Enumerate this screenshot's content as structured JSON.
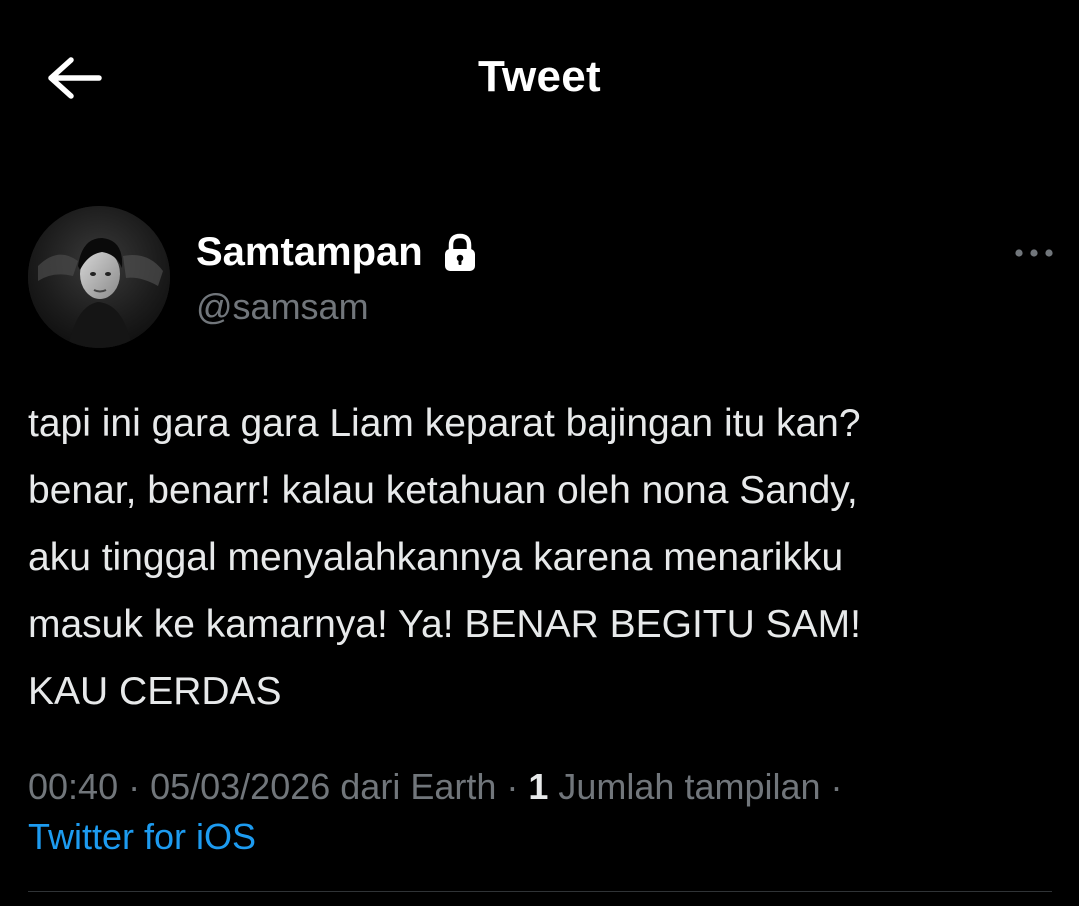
{
  "header": {
    "title": "Tweet",
    "back_icon": "arrow-left-icon"
  },
  "tweet": {
    "author": {
      "display_name": "Samtampan",
      "handle": "@samsam",
      "protected_icon": "lock-icon",
      "avatar": "profile-photo"
    },
    "more_icon": "more-horizontal-icon",
    "text": "tapi ini gara gara Liam keparat bajingan itu kan?\nbenar, benarr! kalau ketahuan oleh nona Sandy,\naku tinggal menyalahkannya karena menarikku\nmasuk ke kamarnya! Ya! BENAR BEGITU SAM!\nKAU CERDAS",
    "meta": {
      "time": "00:40",
      "separator": " · ",
      "date": "05/03/2026",
      "location_text": " dari Earth",
      "views_count": "1",
      "views_label": " Jumlah tampilan",
      "source": "Twitter for iOS"
    }
  },
  "colors": {
    "background": "#000000",
    "text_primary": "#e7e9ea",
    "text_secondary": "#71767b",
    "link": "#1d9bf0",
    "divider": "#2f3336"
  }
}
